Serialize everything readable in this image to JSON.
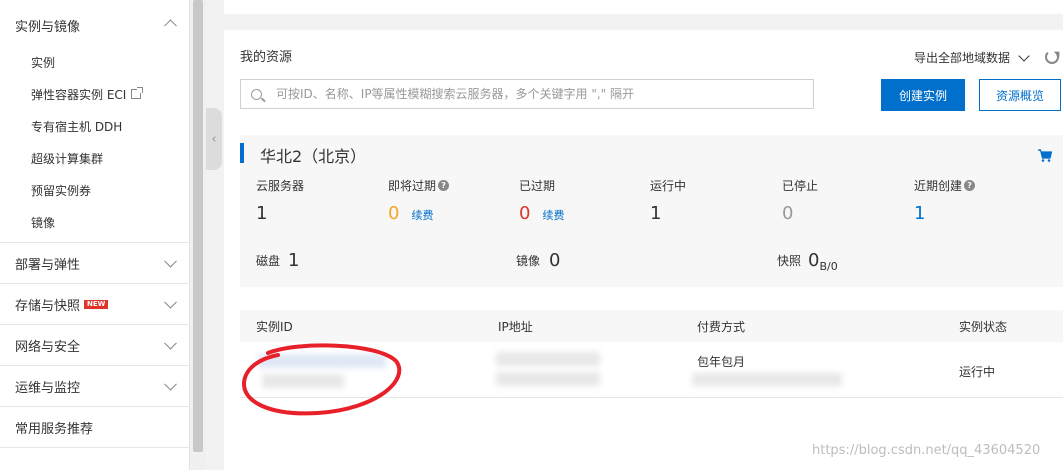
{
  "sidebar": {
    "groups": [
      {
        "label": "实例与镜像",
        "expanded": true,
        "items": [
          {
            "label": "实例"
          },
          {
            "label": "弹性容器实例 ECI",
            "external": true
          },
          {
            "label": "专有宿主机 DDH"
          },
          {
            "label": "超级计算集群"
          },
          {
            "label": "预留实例券"
          },
          {
            "label": "镜像"
          }
        ]
      },
      {
        "label": "部署与弹性",
        "expanded": false
      },
      {
        "label": "存储与快照",
        "expanded": false,
        "badge": "NEW"
      },
      {
        "label": "网络与安全",
        "expanded": false
      },
      {
        "label": "运维与监控",
        "expanded": false
      },
      {
        "label": "常用服务推荐",
        "expanded": false
      }
    ]
  },
  "resources": {
    "title": "我的资源",
    "export_label": "导出全部地域数据",
    "search_placeholder": "可按ID、名称、IP等属性模糊搜索云服务器，多个关键字用 \",\" 隔开",
    "create_button": "创建实例",
    "overview_button": "资源概览"
  },
  "region": {
    "name": "华北2（北京）",
    "stats": [
      {
        "label": "云服务器",
        "value": "1"
      },
      {
        "label": "即将过期",
        "value": "0",
        "renew": "续费",
        "help": true
      },
      {
        "label": "已过期",
        "value": "0",
        "renew": "续费"
      },
      {
        "label": "运行中",
        "value": "1"
      },
      {
        "label": "已停止",
        "value": "0"
      },
      {
        "label": "近期创建",
        "value": "1",
        "help": true
      }
    ],
    "row2": [
      {
        "label": "磁盘",
        "value": "1"
      },
      {
        "label": "镜像",
        "value": "0"
      },
      {
        "label": "快照",
        "value": "0",
        "sub": "B/0"
      }
    ]
  },
  "table": {
    "columns": [
      "实例ID",
      "IP地址",
      "付费方式",
      "实例状态"
    ],
    "rows": [
      {
        "pay_type": "包年包月",
        "status": "运行中"
      }
    ]
  },
  "watermark": "https://blog.csdn.net/qq_43604520",
  "colors": {
    "primary": "#0070cc",
    "orange": "#f5a623",
    "red": "#e0352b",
    "annotation": "#e8202a"
  }
}
